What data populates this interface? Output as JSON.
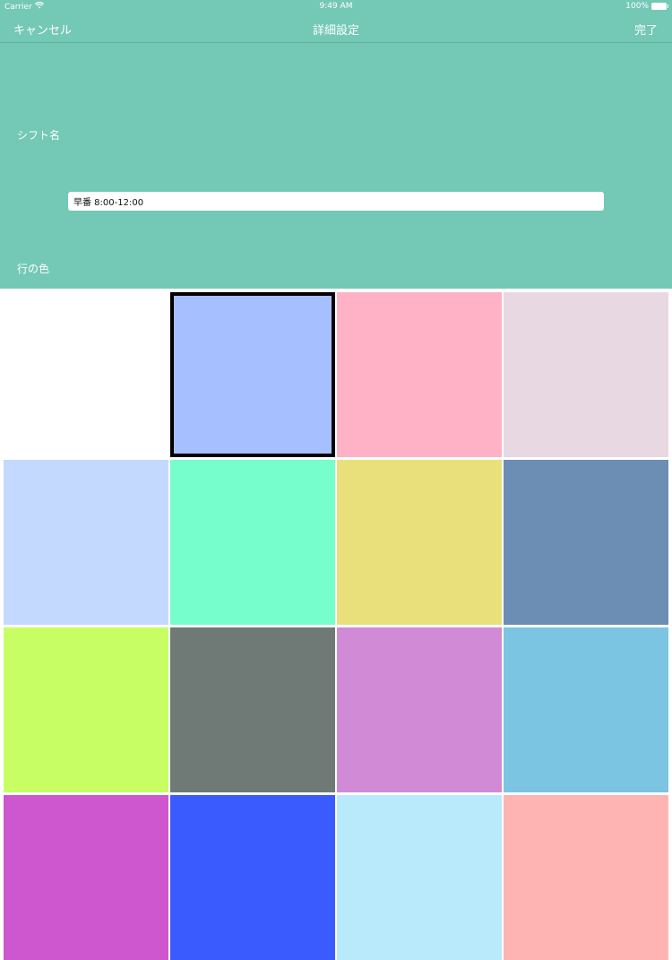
{
  "status_bar": {
    "carrier": "Carrier",
    "time": "9:49 AM",
    "battery": "100%"
  },
  "navbar": {
    "cancel_label": "キャンセル",
    "title": "詳細設定",
    "done_label": "完了"
  },
  "form": {
    "shift_name_label": "シフト名",
    "shift_name_value": "早番 8:00-12:00",
    "row_color_label": "行の色"
  },
  "colors": {
    "header_bg": "#74c8b6",
    "selected_border": "#000000"
  },
  "color_swatches": [
    {
      "color": "#ffffff",
      "selected": false
    },
    {
      "color": "#a6bffe",
      "selected": true
    },
    {
      "color": "#ffb2c6",
      "selected": false
    },
    {
      "color": "#e8d8e2",
      "selected": false
    },
    {
      "color": "#c4d9fe",
      "selected": false
    },
    {
      "color": "#76fecc",
      "selected": false
    },
    {
      "color": "#e9e07c",
      "selected": false
    },
    {
      "color": "#6c8db4",
      "selected": false
    },
    {
      "color": "#c6fe64",
      "selected": false
    },
    {
      "color": "#6f7a77",
      "selected": false
    },
    {
      "color": "#d08ad6",
      "selected": false
    },
    {
      "color": "#7bc4e2",
      "selected": false
    },
    {
      "color": "#ce56ce",
      "selected": false
    },
    {
      "color": "#3a5cfe",
      "selected": false
    },
    {
      "color": "#b8eafc",
      "selected": false
    },
    {
      "color": "#ffb4b4",
      "selected": false
    }
  ]
}
